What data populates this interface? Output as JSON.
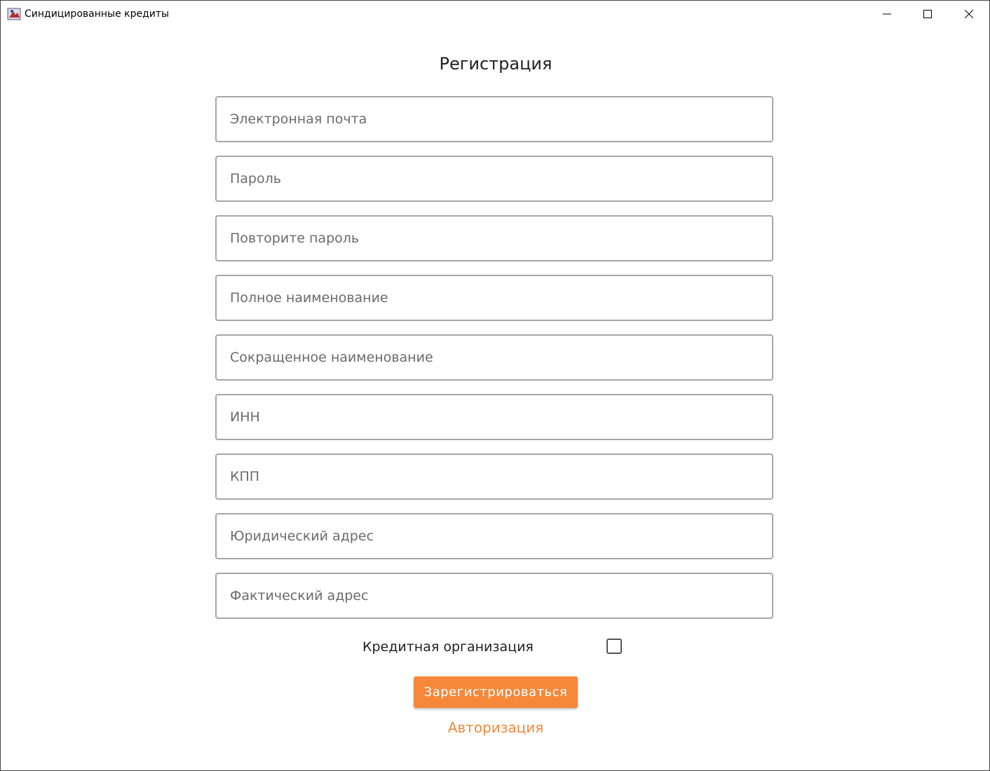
{
  "window": {
    "title": "Синдицированные кредиты",
    "icon": "java-app-icon",
    "controls": [
      "minimize-icon",
      "maximize-icon",
      "close-icon"
    ]
  },
  "form": {
    "title": "Регистрация",
    "fields": [
      {
        "placeholder": "Электронная почта",
        "value": ""
      },
      {
        "placeholder": "Пароль",
        "value": ""
      },
      {
        "placeholder": "Повторите пароль",
        "value": ""
      },
      {
        "placeholder": "Полное наименование",
        "value": ""
      },
      {
        "placeholder": "Сокращенное наименование",
        "value": ""
      },
      {
        "placeholder": "ИНН",
        "value": ""
      },
      {
        "placeholder": "КПП",
        "value": ""
      },
      {
        "placeholder": "Юридический адрес",
        "value": ""
      },
      {
        "placeholder": "Фактический адрес",
        "value": ""
      }
    ],
    "credit_org_label": "Кредитная организация",
    "credit_org_checked": false,
    "submit_label": "Зарегистрироваться",
    "login_link": "Авторизация"
  },
  "colors": {
    "accent": "#f5883a",
    "field_border": "#a6a6a6",
    "text": "#222222"
  }
}
